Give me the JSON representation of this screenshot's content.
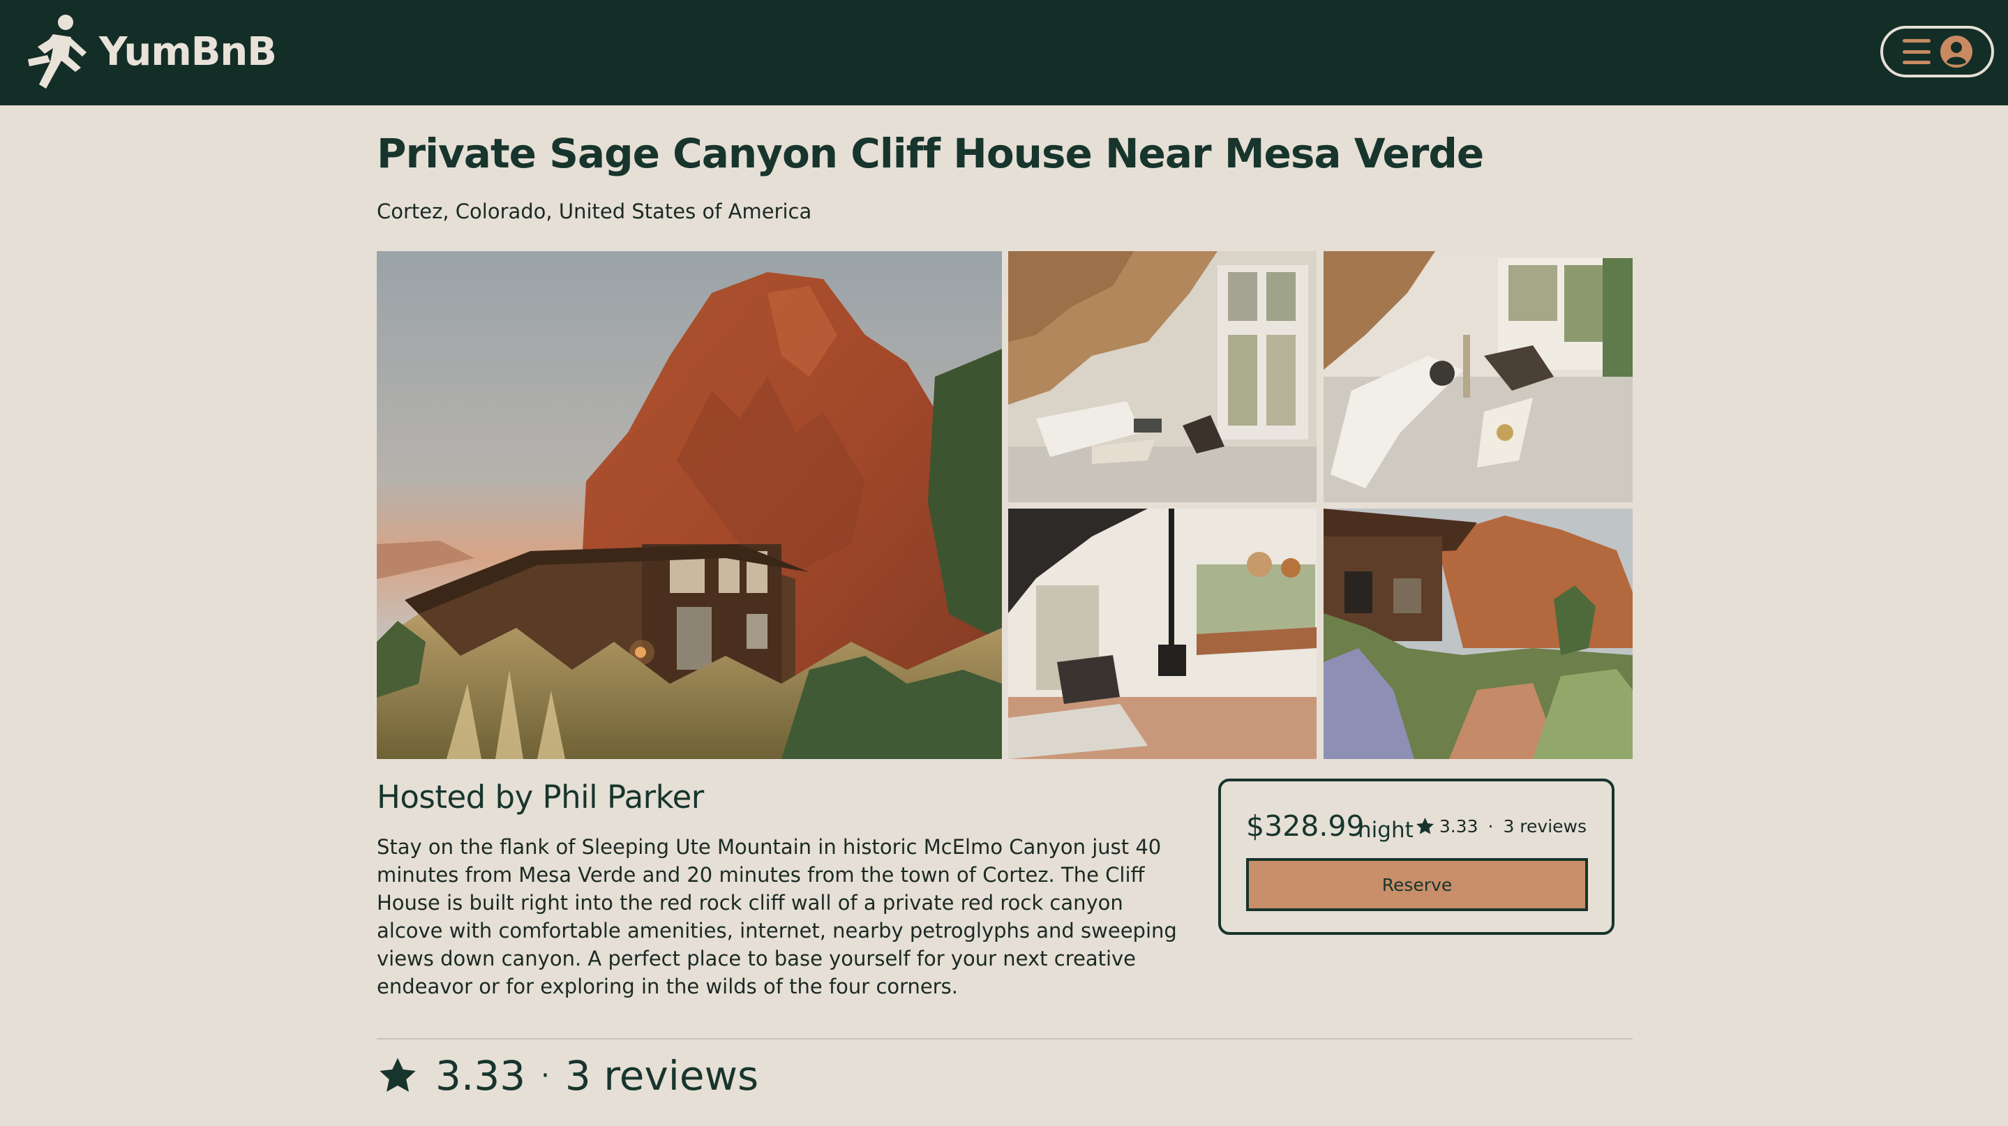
{
  "app": {
    "name": "YumbnB"
  },
  "header": {
    "brand_name": "YumBnB",
    "logo_icon": "running-person-icon",
    "menu_icon": "hamburger-icon",
    "avatar_icon": "user-avatar-icon"
  },
  "listing": {
    "title": "Private Sage Canyon Cliff House Near Mesa Verde",
    "location": "Cortez, Colorado, United States of America",
    "host_heading": "Hosted by Phil Parker",
    "description": "Stay on the flank of Sleeping Ute Mountain in historic McElmo Canyon just 40 minutes from Mesa Verde and 20 minutes from the town of Cortez. The Cliff House is built right into the red rock cliff wall of a private red rock canyon alcove with comfortable amenities, internet, nearby petroglyphs and sweeping views down canyon. A perfect place to base yourself for your next creative endeavor or for exploring in the wilds of the four corners."
  },
  "booking": {
    "price": "$328.99",
    "per_unit": "night",
    "rating": "3.33",
    "separator": "·",
    "reviews": "3 reviews",
    "reserve_label": "Reserve"
  },
  "summary": {
    "rating": "3.33",
    "separator": "·",
    "reviews": "3 reviews"
  },
  "colors": {
    "header_bg": "#132e27",
    "page_bg": "#e6dfd6",
    "accent": "#c98e6a",
    "primary_text": "#17352c"
  }
}
